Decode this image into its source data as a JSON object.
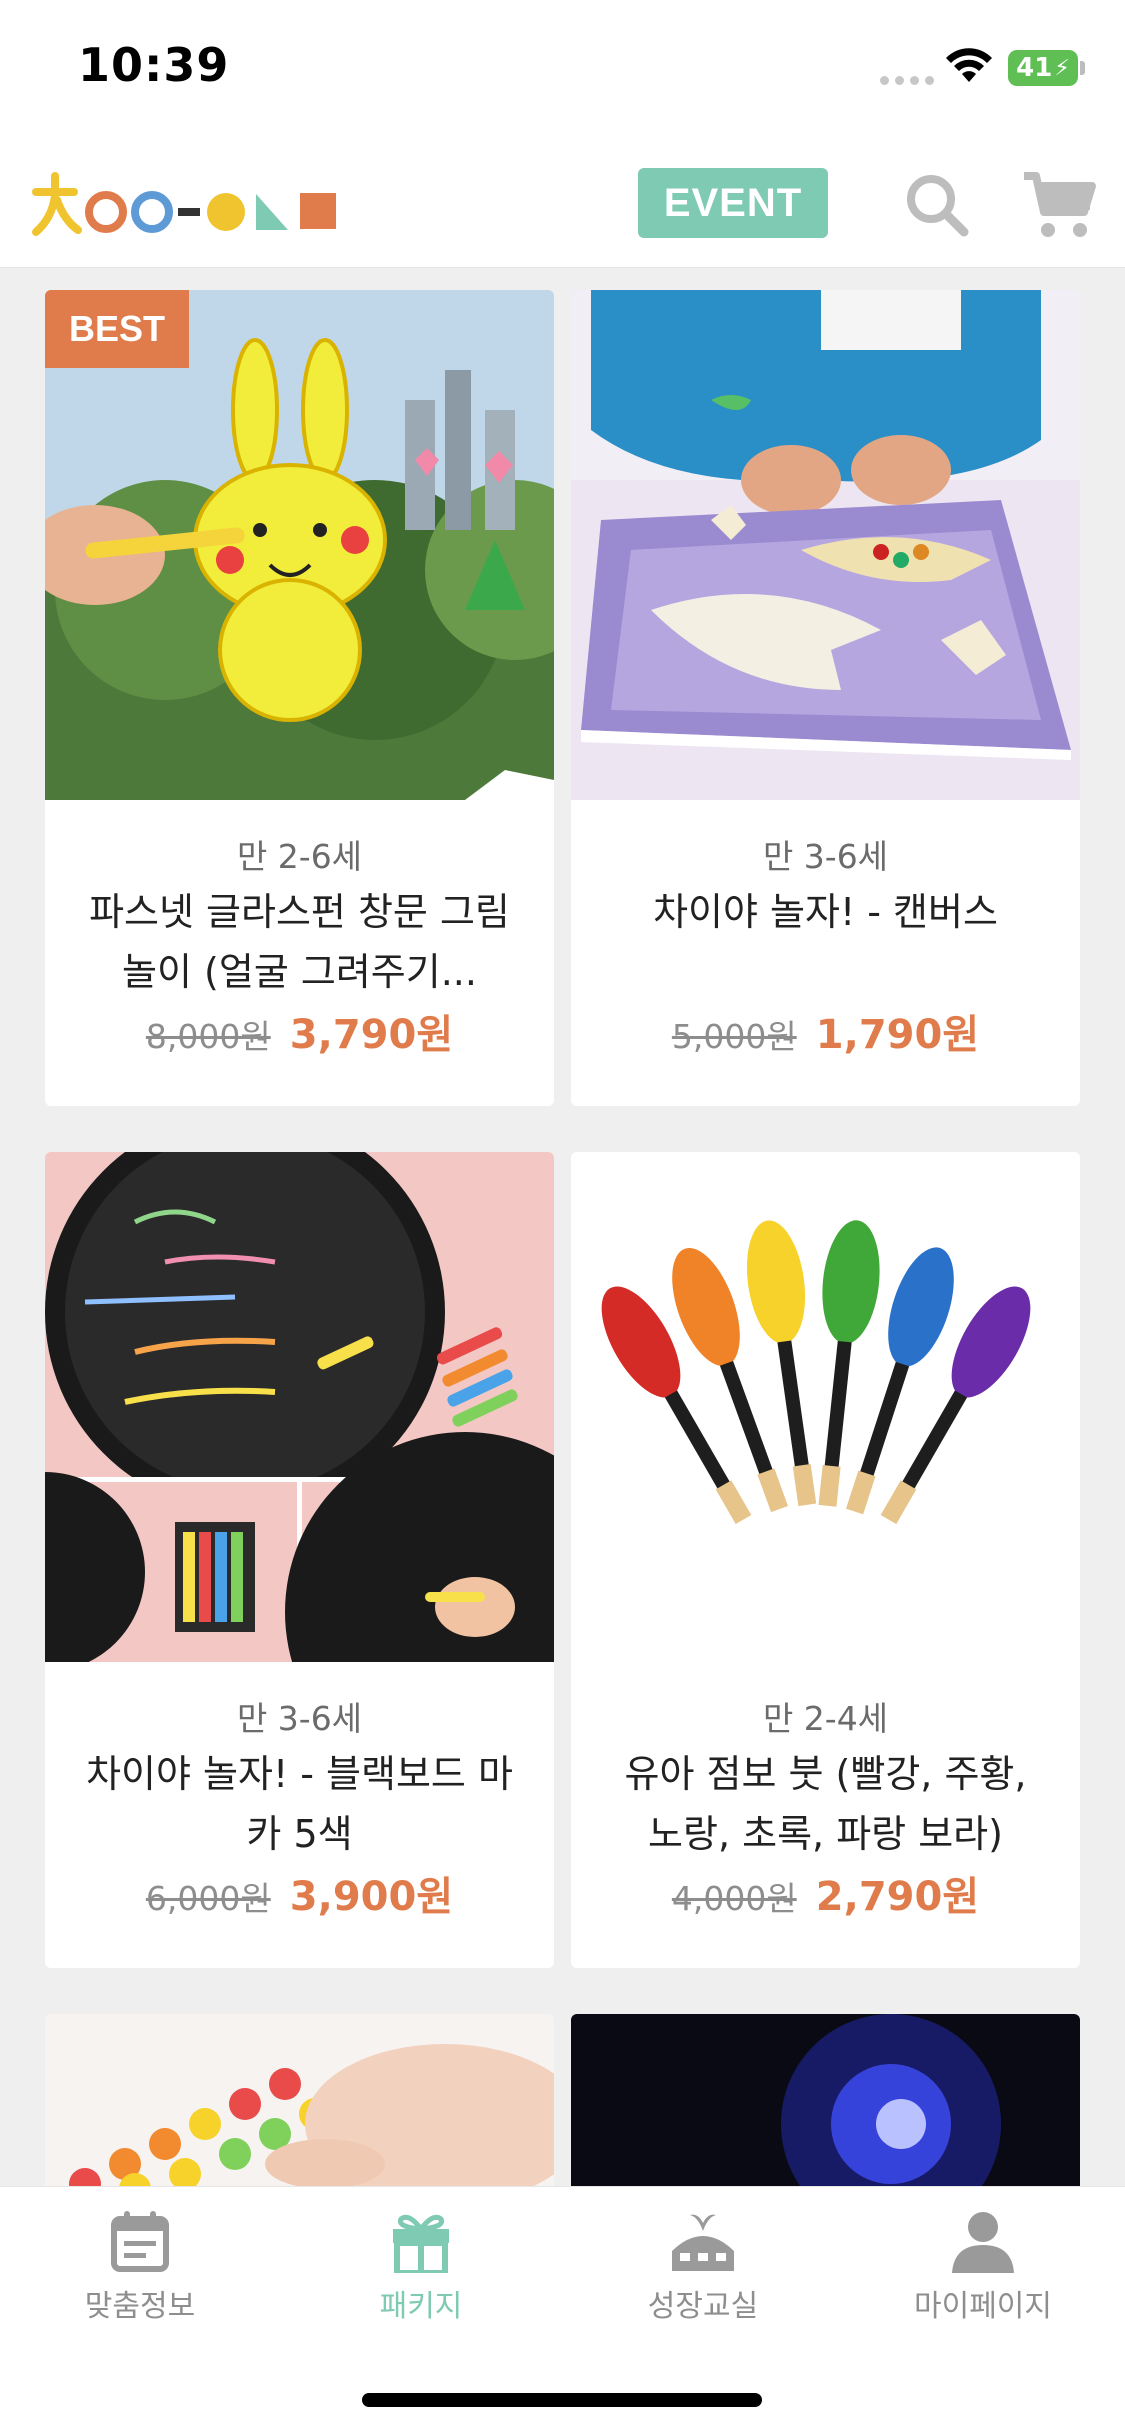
{
  "status": {
    "time": "10:39",
    "battery": "41"
  },
  "header": {
    "event_label": "EVENT"
  },
  "colors": {
    "accent": "#7ecab2",
    "price": "#e07b4b",
    "badge": "#e07b4b"
  },
  "products": [
    {
      "badge": "BEST",
      "age": "만 2-6세",
      "name": "파스넷 글라스펀 창문 그림 놀이 (얼굴 그려주기...",
      "original_price": "8,000원",
      "sale_price": "3,790원"
    },
    {
      "age": "만 3-6세",
      "name": "차이야 놀자! - 캔버스",
      "original_price": "5,000원",
      "sale_price": "1,790원"
    },
    {
      "age": "만 3-6세",
      "name": "차이야 놀자! - 블랙보드 마카 5색",
      "original_price": "6,000원",
      "sale_price": "3,900원"
    },
    {
      "age": "만 2-4세",
      "name": "유아 점보 붓 (빨강, 주황, 노랑, 초록, 파랑 보라)",
      "original_price": "4,000원",
      "sale_price": "2,790원"
    }
  ],
  "tabs": [
    {
      "label": "맞춤정보",
      "icon": "calendar-icon"
    },
    {
      "label": "패키지",
      "icon": "gift-icon",
      "active": true
    },
    {
      "label": "성장교실",
      "icon": "school-icon"
    },
    {
      "label": "마이페이지",
      "icon": "person-icon"
    }
  ]
}
